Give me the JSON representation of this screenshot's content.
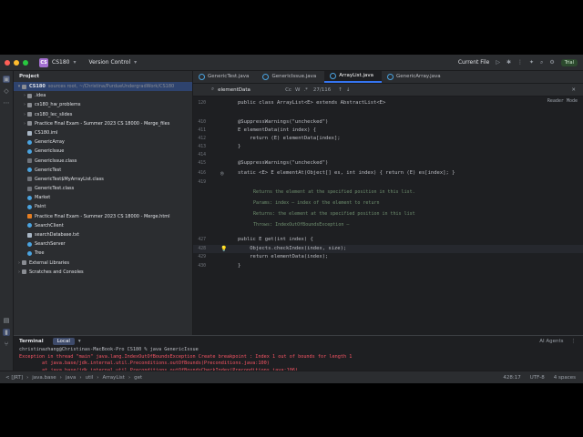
{
  "titlebar": {
    "project_badge": "CS",
    "project_name": "CS180",
    "vcs_label": "Version Control",
    "run_config": "Current File",
    "trial_label": "Trial"
  },
  "project_panel": {
    "title": "Project",
    "root_label": "CS180",
    "root_path": "sources root, ~/Christina/PurdueUndergradWork/CS180",
    "items": [
      {
        "label": ".idea",
        "type": "folder",
        "indent": 1,
        "expandable": true
      },
      {
        "label": "cs180_hw_problems",
        "type": "folder",
        "indent": 1,
        "expandable": true
      },
      {
        "label": "cs180_lec_slides",
        "type": "folder",
        "indent": 1,
        "expandable": true
      },
      {
        "label": "Practice Final Exam - Summer 2023 CS 18000 - Merge_files",
        "type": "folder",
        "indent": 1,
        "expandable": true
      },
      {
        "label": "CS180.iml",
        "type": "file",
        "indent": 1,
        "expandable": false
      },
      {
        "label": "GenericArray",
        "type": "java",
        "indent": 1,
        "expandable": false
      },
      {
        "label": "GenericIssue",
        "type": "java",
        "indent": 1,
        "expandable": false
      },
      {
        "label": "GenericIssue.class",
        "type": "class",
        "indent": 1,
        "expandable": false
      },
      {
        "label": "GenericTest",
        "type": "java",
        "indent": 1,
        "expandable": false
      },
      {
        "label": "GenericTest$MyArrayList.class",
        "type": "class",
        "indent": 1,
        "expandable": false
      },
      {
        "label": "GenericTest.class",
        "type": "class",
        "indent": 1,
        "expandable": false
      },
      {
        "label": "Market",
        "type": "java",
        "indent": 1,
        "expandable": false
      },
      {
        "label": "Paint",
        "type": "java",
        "indent": 1,
        "expandable": false
      },
      {
        "label": "Practice Final Exam - Summer 2023 CS 18000 - Merge.html",
        "type": "html",
        "indent": 1,
        "expandable": false
      },
      {
        "label": "SearchClient",
        "type": "java",
        "indent": 1,
        "expandable": false
      },
      {
        "label": "searchDatabase.txt",
        "type": "file",
        "indent": 1,
        "expandable": false
      },
      {
        "label": "SearchServer",
        "type": "java",
        "indent": 1,
        "expandable": false
      },
      {
        "label": "Tree",
        "type": "java",
        "indent": 1,
        "expandable": false
      },
      {
        "label": "External Libraries",
        "type": "lib",
        "indent": 0,
        "expandable": true
      },
      {
        "label": "Scratches and Consoles",
        "type": "scratch",
        "indent": 0,
        "expandable": true
      }
    ]
  },
  "tabs": [
    "GenericTest.java",
    "GenericIssue.java",
    "ArrayList.java",
    "GenericArray.java"
  ],
  "active_tab": 2,
  "findbar": {
    "query": "elementData",
    "opt_case": "Cc",
    "opt_word": "W",
    "opt_regex": ".*",
    "count": "27/116"
  },
  "editor": {
    "reader_mode": "Reader Mode",
    "lines": [
      {
        "no": "120",
        "code": "public class ArrayList<E> extends AbstractList<E>"
      },
      {
        "no": "",
        "code": ""
      },
      {
        "no": "410",
        "code": "@SuppressWarnings(\"unchecked\")"
      },
      {
        "no": "411",
        "code": "E elementData(int index) {"
      },
      {
        "no": "412",
        "code": "    return (E) elementData[index];"
      },
      {
        "no": "413",
        "code": "}"
      },
      {
        "no": "414",
        "code": ""
      },
      {
        "no": "415",
        "code": "@SuppressWarnings(\"unchecked\")"
      },
      {
        "no": "416",
        "code": "static <E> E elementAt(Object[] es, int index) { return (E) es[index]; }"
      },
      {
        "no": "419",
        "code": ""
      }
    ],
    "doc_lines": [
      "Returns the element at the specified position in this list.",
      "Params:  index – index of the element to return",
      "Returns: the element at the specified position in this list",
      "Throws:  IndexOutOfBoundsException –"
    ],
    "lines2": [
      {
        "no": "427",
        "code": "public E get(int index) {"
      },
      {
        "no": "428",
        "code": "    Objects.checkIndex(index, size);"
      },
      {
        "no": "429",
        "code": "    return elementData(index);"
      },
      {
        "no": "430",
        "code": "}"
      }
    ]
  },
  "terminal": {
    "title": "Terminal",
    "tab": "Local",
    "ai_agents": "AI Agents",
    "lines": [
      {
        "text": "christinazhang@Christinas-MacBook-Pro CS180 % java GenericIssue",
        "kind": "normal"
      },
      {
        "text": "Exception in thread \"main\" java.lang.IndexOutOfBoundsException Create breakpoint : Index 1 out of bounds for length 1",
        "kind": "error"
      },
      {
        "text": "        at java.base/jdk.internal.util.Preconditions.outOfBounds(Preconditions.java:100)",
        "kind": "stack"
      },
      {
        "text": "        at java.base/jdk.internal.util.Preconditions.outOfBoundsCheckIndex(Preconditions.java:106)",
        "kind": "stack"
      },
      {
        "text": "        at java.base/jdk.internal.util.Preconditions.checkIndex(Preconditions.java:302)",
        "kind": "stack"
      },
      {
        "text": "        at java.base/java.util.Objects.checkIndex(Objects.java:365)",
        "kind": "stack"
      },
      {
        "text": "        at java.base/java.util.ArrayList.get(ArrayList.java:428)",
        "kind": "stack"
      },
      {
        "text": "        at GenericIssue.main(GenericIssue.java:14)",
        "kind": "stack"
      },
      {
        "text": "",
        "kind": "normal"
      },
      {
        "text": "christinazhang@Christinas-MacBook-Pro CS180 %",
        "kind": "normal"
      }
    ]
  },
  "status": {
    "crumbs": [
      "< [JRT]",
      "java.base",
      "java",
      "util",
      "ArrayList",
      "get"
    ],
    "position": "428:17",
    "encoding": "UTF-8",
    "indent": "4 spaces"
  },
  "colors": {
    "accent": "#3574f0",
    "error": "#f75464",
    "keyword": "#cf8e6d",
    "function": "#56a8f5"
  }
}
